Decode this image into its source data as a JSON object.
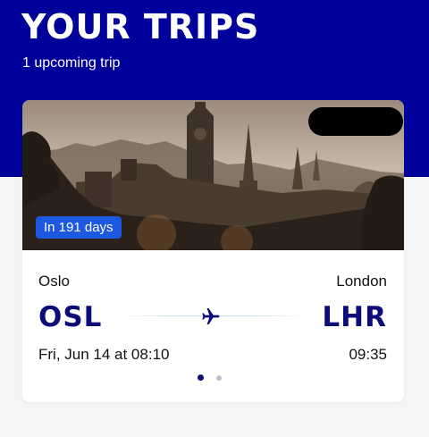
{
  "header": {
    "title": "YOUR TRIPS",
    "subtitle": "1 upcoming trip"
  },
  "trip": {
    "countdown": "In 191 days",
    "origin": {
      "city": "Oslo",
      "code": "OSL",
      "time": "Fri, Jun 14 at 08:10"
    },
    "destination": {
      "city": "London",
      "code": "LHR",
      "time": "09:35"
    },
    "image_subject": "city skyline at sunset"
  },
  "pager": {
    "count": 2,
    "active_index": 0
  },
  "icons": {
    "route": "airplane-icon"
  },
  "colors": {
    "brand": "#00009a",
    "code_text": "#0d0d7a",
    "badge": "#1d58e0",
    "background": "#f5f5f7"
  }
}
